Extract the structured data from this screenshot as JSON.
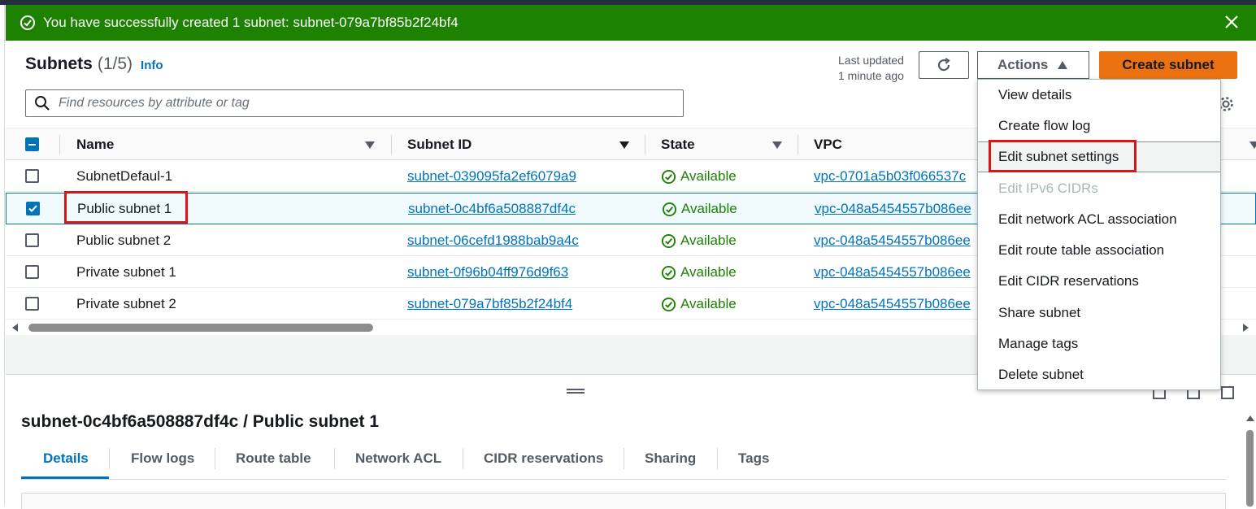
{
  "flash": {
    "message": "You have successfully created 1 subnet: subnet-079a7bf85b2f24bf4",
    "icon": "success-check-icon",
    "color": "#1d8102"
  },
  "header": {
    "title": "Subnets",
    "count": "(1/5)",
    "info": "Info",
    "last_updated_line1": "Last updated",
    "last_updated_line2": "1 minute ago",
    "actions_label": "Actions",
    "create_label": "Create subnet"
  },
  "search": {
    "placeholder": "Find resources by attribute or tag"
  },
  "table": {
    "columns": [
      "Name",
      "Subnet ID",
      "State",
      "VPC"
    ],
    "rows": [
      {
        "name": "SubnetDefaul-1",
        "subnet_id": "subnet-039095fa2ef6079a9",
        "state": "Available",
        "vpc": "vpc-0701a5b03f066537c",
        "selected": false
      },
      {
        "name": "Public subnet 1",
        "subnet_id": "subnet-0c4bf6a508887df4c",
        "state": "Available",
        "vpc": "vpc-048a5454557b086ee",
        "selected": true
      },
      {
        "name": "Public subnet 2",
        "subnet_id": "subnet-06cefd1988bab9a4c",
        "state": "Available",
        "vpc": "vpc-048a5454557b086ee",
        "selected": false
      },
      {
        "name": "Private subnet 1",
        "subnet_id": "subnet-0f96b04ff976d9f63",
        "state": "Available",
        "vpc": "vpc-048a5454557b086ee",
        "selected": false
      },
      {
        "name": "Private subnet 2",
        "subnet_id": "subnet-079a7bf85b2f24bf4",
        "state": "Available",
        "vpc": "vpc-048a5454557b086ee",
        "selected": false
      }
    ]
  },
  "actions_menu": {
    "items": [
      {
        "label": "View details",
        "disabled": false
      },
      {
        "label": "Create flow log",
        "disabled": false
      },
      {
        "label": "Edit subnet settings",
        "disabled": false,
        "highlighted": true
      },
      {
        "label": "Edit IPv6 CIDRs",
        "disabled": true
      },
      {
        "label": "Edit network ACL association",
        "disabled": false
      },
      {
        "label": "Edit route table association",
        "disabled": false
      },
      {
        "label": "Edit CIDR reservations",
        "disabled": false
      },
      {
        "label": "Share subnet",
        "disabled": false
      },
      {
        "label": "Manage tags",
        "disabled": false
      },
      {
        "label": "Delete subnet",
        "disabled": false
      }
    ]
  },
  "details": {
    "title": "subnet-0c4bf6a508887df4c / Public subnet 1",
    "tabs": [
      "Details",
      "Flow logs",
      "Route table",
      "Network ACL",
      "CIDR reservations",
      "Sharing",
      "Tags"
    ],
    "active_tab": "Details"
  },
  "colors": {
    "accent": "#0073bb",
    "primary_button": "#ec7211",
    "success": "#1d8102",
    "annotation_red": "#d91515"
  }
}
